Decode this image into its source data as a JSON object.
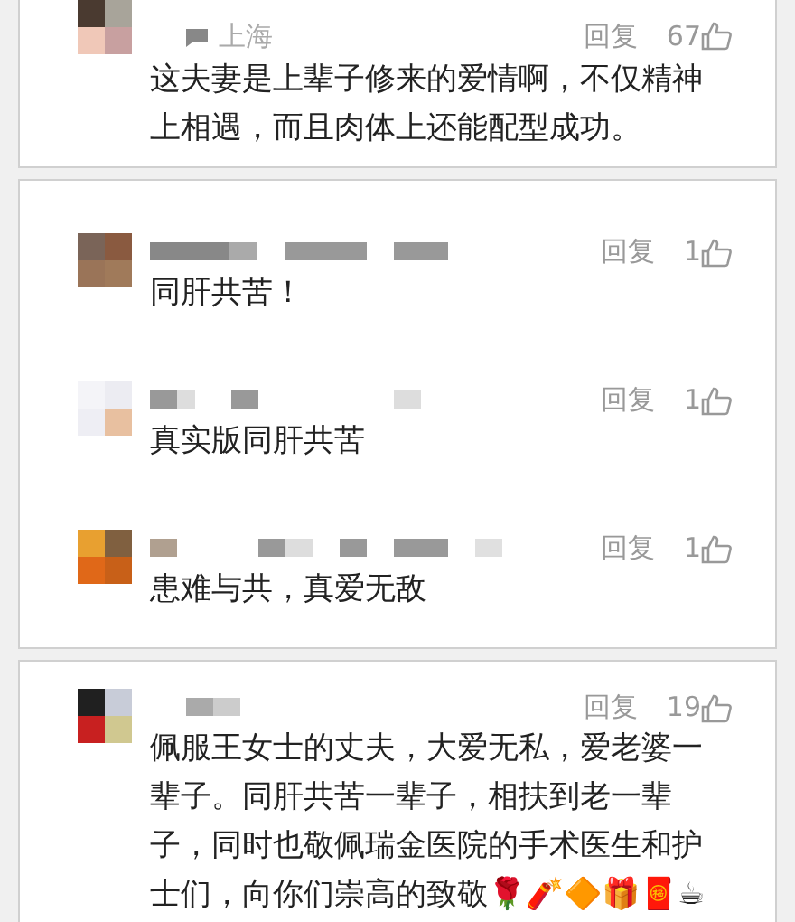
{
  "threads": [
    {
      "comments": [
        {
          "location": "上海",
          "reply": "回复",
          "likes": "67",
          "text": "这夫妻是上辈子修来的爱情啊，不仅精神上相遇，而且肉体上还能配型成功。"
        }
      ]
    },
    {
      "comments": [
        {
          "reply": "回复",
          "likes": "1",
          "text": "同肝共苦！"
        },
        {
          "reply": "回复",
          "likes": "1",
          "text": "真实版同肝共苦"
        },
        {
          "reply": "回复",
          "likes": "1",
          "text": "患难与共，真爱无敌"
        }
      ]
    },
    {
      "comments": [
        {
          "reply": "回复",
          "likes": "19",
          "text": "佩服王女士的丈夫，大爱无私，爱老婆一辈子。同肝共苦一辈子，相扶到老一辈子，同时也敬佩瑞金医院的手术医生和护士们，向你们崇高的致敬🌹🧨🔶🎁🧧☕"
        }
      ]
    }
  ]
}
